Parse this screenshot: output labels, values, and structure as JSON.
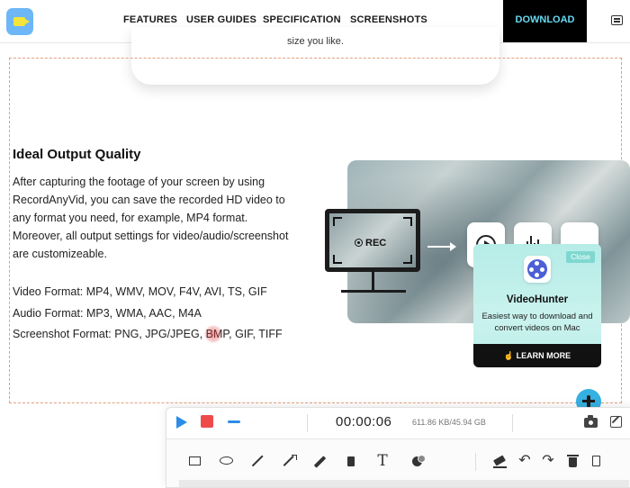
{
  "nav": {
    "items": [
      "FEATURES",
      "USER GUIDES",
      "SPECIFICATION",
      "SCREENSHOTS"
    ],
    "download": "DOWNLOAD"
  },
  "top_card": {
    "text": "size you like."
  },
  "section": {
    "heading": "Ideal Output Quality",
    "body": "After capturing the footage of your screen by using RecordAnyVid, you can save the recorded HD video to any format you need, for example, MP4 format. Moreover, all output settings for video/audio/screenshot are customizeable.",
    "video_formats": "Video Format: MP4, WMV, MOV, F4V, AVI, TS, GIF",
    "audio_formats": "Audio Format: MP3, WMA, AAC, M4A",
    "screenshot_formats": "Screenshot Format: PNG, JPG/JPEG, BMP, GIF, TIFF"
  },
  "illustration": {
    "rec_label": "REC"
  },
  "ad": {
    "close": "Close",
    "title": "VideoHunter",
    "subtitle": "Easiest way to download and convert videos on Mac",
    "button": "LEARN MORE"
  },
  "recorder": {
    "time": "00:00:06",
    "size": "611.86 KB/45.94 GB",
    "accent_play": "#2c8de6",
    "accent_stop": "#ee4a4a",
    "text_tool": "T",
    "undo": "↶",
    "redo": "↷"
  },
  "colors": {
    "download_bg": "#000000",
    "download_text": "#66d9f1",
    "frame_border": "#e3a07a"
  }
}
